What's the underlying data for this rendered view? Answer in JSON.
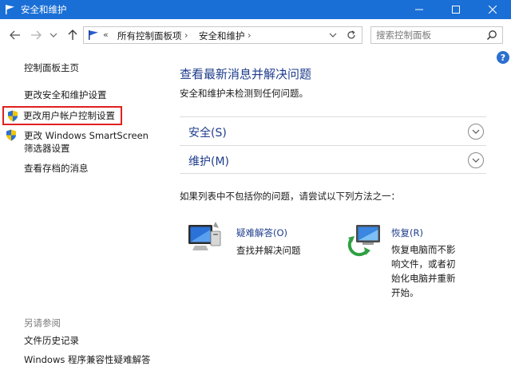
{
  "window": {
    "title": "安全和维护",
    "accent": "#1a6fd6"
  },
  "address_bar": {
    "chevron": "«",
    "breadcrumbs": [
      "所有控制面板项",
      "安全和维护"
    ],
    "separator": "›"
  },
  "search": {
    "placeholder": "搜索控制面板"
  },
  "help": {
    "label": "?"
  },
  "sidebar": {
    "home": "控制面板主页",
    "security_settings": "更改安全和维护设置",
    "uac_settings": "更改用户帐户控制设置",
    "smartscreen_line1": "更改 Windows SmartScreen",
    "smartscreen_line2": "筛选器设置",
    "archived_messages": "查看存档的消息",
    "see_also": "另请参阅",
    "file_history": "文件历史记录",
    "compat_troubleshooter": "Windows 程序兼容性疑难解答"
  },
  "main": {
    "title": "查看最新消息并解决问题",
    "subtitle": "安全和维护未检测到任何问题。",
    "sections": [
      {
        "label": "安全(S)"
      },
      {
        "label": "维护(M)"
      }
    ],
    "try_text": "如果列表中不包括你的问题，请尝试以下列方法之一：",
    "tools": [
      {
        "title": "疑难解答(O)",
        "desc": "查找并解决问题"
      },
      {
        "title": "恢复(R)",
        "desc": "恢复电脑而不影响文件，或者初始化电脑并重新开始。"
      }
    ]
  },
  "colors": {
    "link_blue": "#1e3c8c",
    "highlight_red": "#e02020"
  }
}
